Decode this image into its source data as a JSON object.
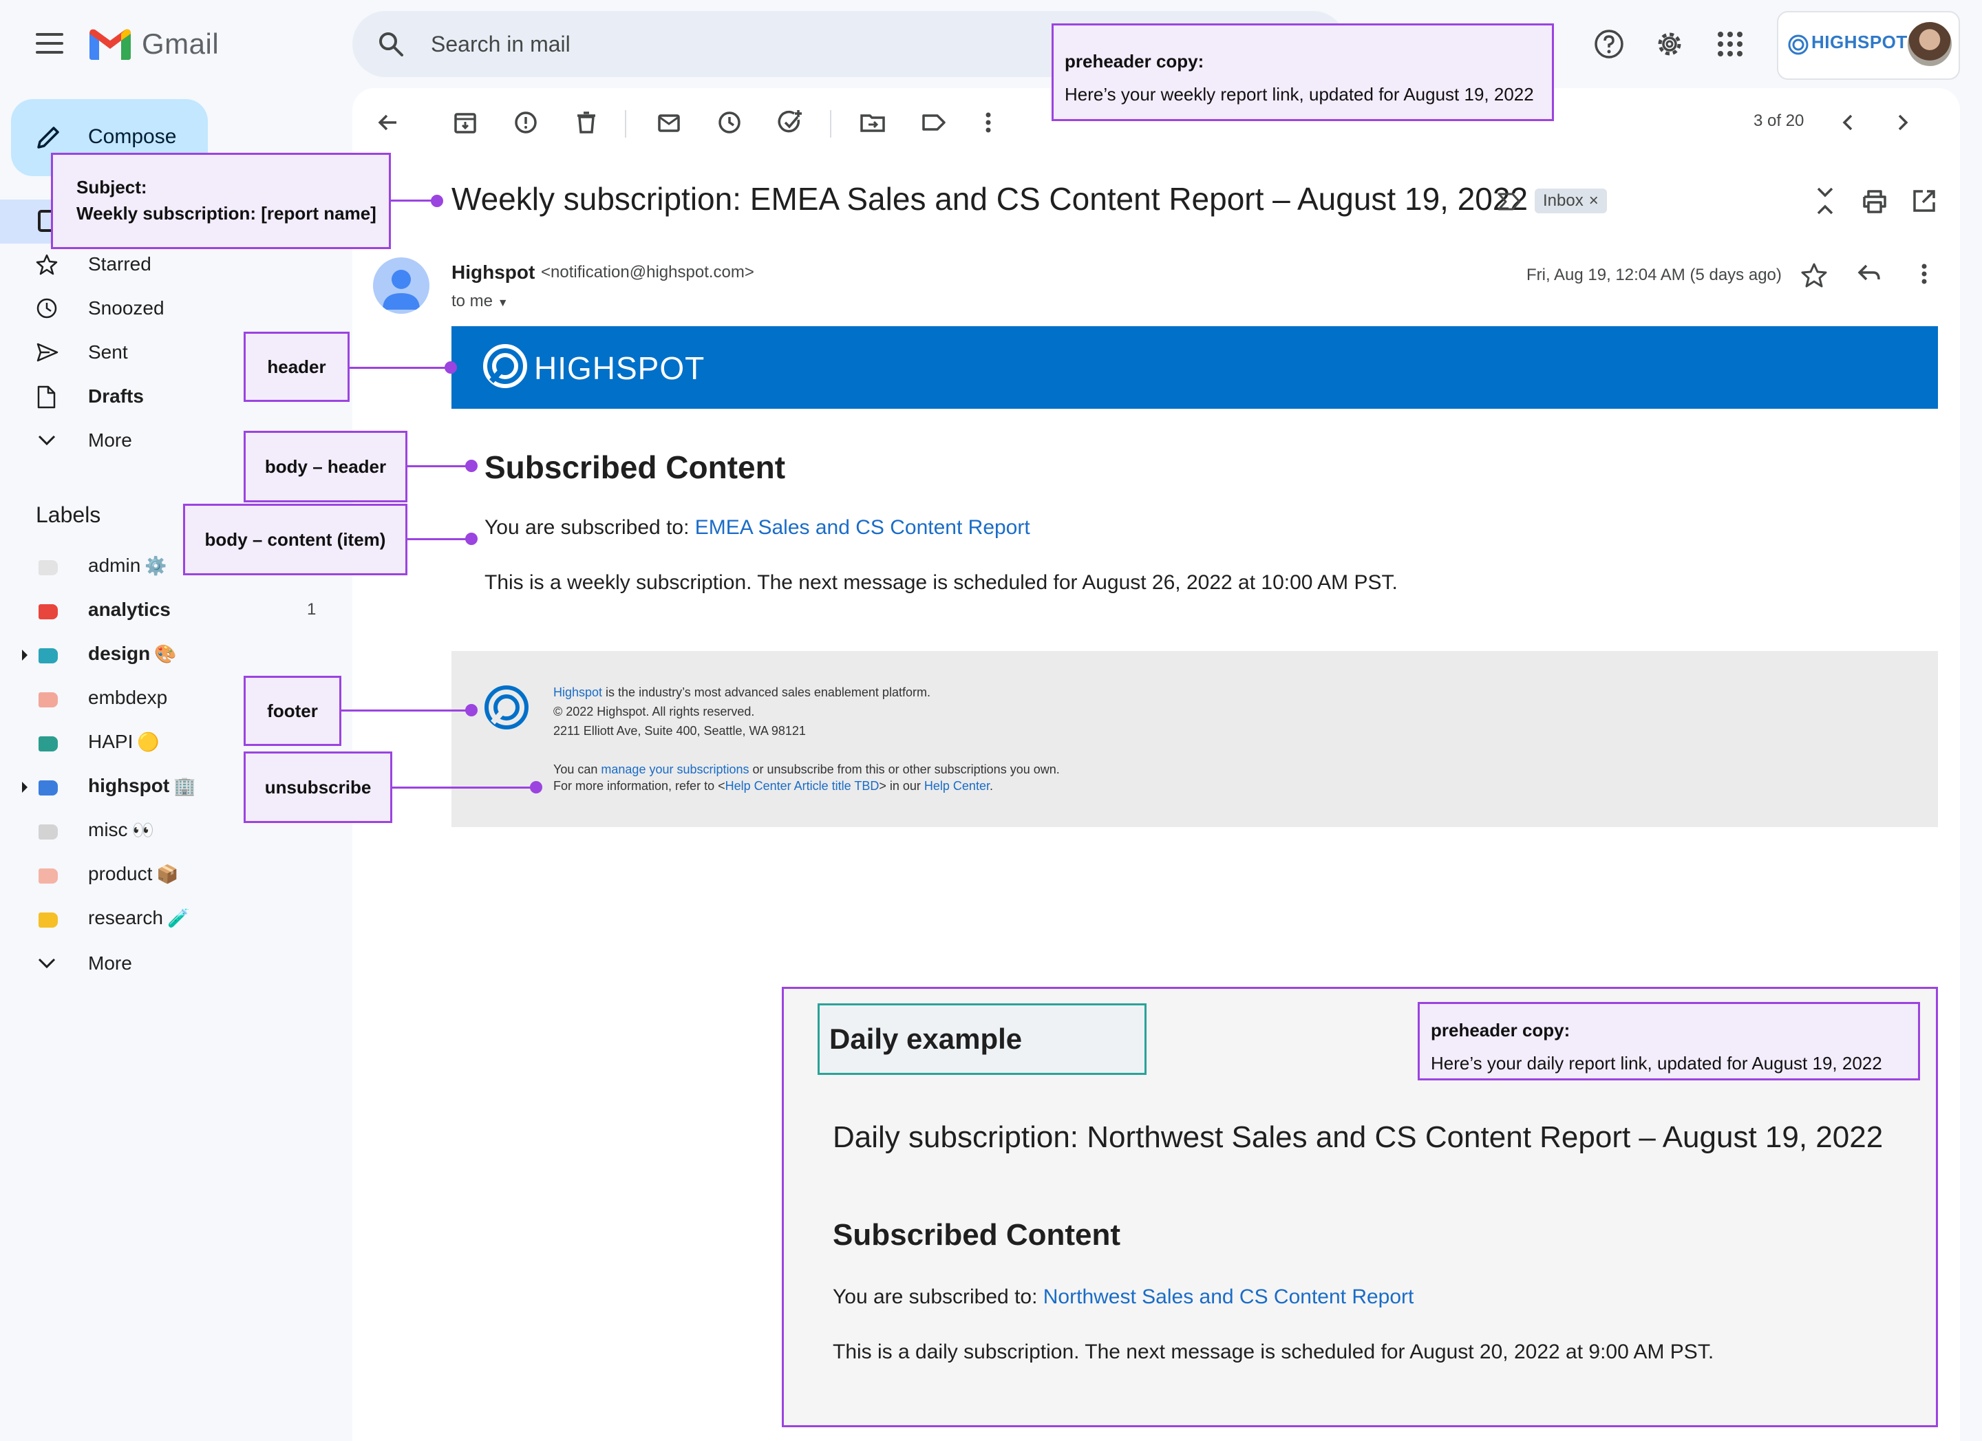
{
  "app": {
    "name": "Gmail"
  },
  "search": {
    "placeholder": "Search in mail"
  },
  "account": {
    "brand": "HIGHSPOT"
  },
  "sidebar": {
    "compose_label": "Compose",
    "nav": [
      {
        "label": "Starred",
        "icon": "star-icon",
        "bold": false
      },
      {
        "label": "Snoozed",
        "icon": "clock-icon",
        "bold": false
      },
      {
        "label": "Sent",
        "icon": "send-icon",
        "bold": false
      },
      {
        "label": "Drafts",
        "icon": "draft-icon",
        "bold": true
      },
      {
        "label": "More",
        "icon": "chevron-down-icon",
        "bold": false
      }
    ],
    "labels_title": "Labels",
    "labels": [
      {
        "name": "admin",
        "emoji": "⚙️",
        "color": "#e3e3e3",
        "bold": false,
        "count": "",
        "expandable": false
      },
      {
        "name": "analytics",
        "emoji": "",
        "color": "#e8453c",
        "bold": true,
        "count": "1",
        "expandable": false
      },
      {
        "name": "design",
        "emoji": "🎨",
        "color": "#2aa4b8",
        "bold": true,
        "count": "",
        "expandable": true
      },
      {
        "name": "embdexp",
        "emoji": "",
        "color": "#f2a799",
        "bold": false,
        "count": "",
        "expandable": false
      },
      {
        "name": "HAPI",
        "emoji": "🟡",
        "color": "#2a9d8f",
        "bold": false,
        "count": "",
        "expandable": false
      },
      {
        "name": "highspot",
        "emoji": "🏢",
        "color": "#3b7ddd",
        "bold": true,
        "count": "",
        "expandable": true
      },
      {
        "name": "misc",
        "emoji": "👀",
        "color": "#d3d3d3",
        "bold": false,
        "count": "",
        "expandable": false
      },
      {
        "name": "product",
        "emoji": "📦",
        "color": "#f4b3a4",
        "bold": false,
        "count": "",
        "expandable": false
      },
      {
        "name": "research",
        "emoji": "🧪",
        "color": "#f6bf26",
        "bold": false,
        "count": "",
        "expandable": false
      }
    ],
    "labels_more": "More"
  },
  "toolbar": {
    "pager": "3 of 20"
  },
  "email": {
    "subject": "Weekly subscription: EMEA Sales and CS Content Report – August 19, 2022",
    "inbox_chip": "Inbox",
    "sender_name": "Highspot",
    "sender_email": "<notification@highspot.com>",
    "to_me": "to me",
    "date": "Fri, Aug 19, 12:04 AM (5 days ago)",
    "header_brand": "HIGHSPOT",
    "section_title": "Subscribed Content",
    "subscribed_prefix": "You are subscribed to: ",
    "subscribed_link": "EMEA Sales and CS Content Report",
    "schedule": "This is a weekly subscription. The next message is scheduled for August 26, 2022 at 10:00 AM PST.",
    "footer": {
      "line1_link": "Highspot",
      "line1_rest": " is the industry’s most advanced sales enablement platform.",
      "line2": "© 2022 Highspot. All rights reserved.",
      "line3": "2211 Elliott Ave, Suite 400, Seattle, WA 98121",
      "line4_prefix": "You can ",
      "line4_link": "manage your subscriptions",
      "line4_rest": " or unsubscribe from this or other subscriptions you own.",
      "line5_prefix": "For more information, refer to <",
      "line5_link": "Help Center Article title TBD",
      "line5_mid": "> in our ",
      "line5_link2": "Help Center",
      "line5_end": "."
    }
  },
  "annotations": {
    "preheader_title": "preheader copy:",
    "preheader_text": "Here’s your weekly report link, updated for August 19, 2022",
    "subject_title": "Subject:",
    "subject_text": "Weekly subscription: [report name]",
    "header": "header",
    "body_header": "body – header",
    "body_content": "body – content (item)",
    "footer": "footer",
    "unsubscribe": "unsubscribe"
  },
  "daily": {
    "tag": "Daily example",
    "preheader_title": "preheader copy:",
    "preheader_text": "Here’s your daily report link, updated for August 19, 2022",
    "subject": "Daily subscription: Northwest Sales and CS Content Report – August 19, 2022",
    "section_title": "Subscribed Content",
    "subscribed_prefix": "You are subscribed to: ",
    "subscribed_link": "Northwest Sales and CS Content Report",
    "schedule": "This is a daily subscription. The next message is scheduled for August 20, 2022 at 9:00 AM PST."
  }
}
